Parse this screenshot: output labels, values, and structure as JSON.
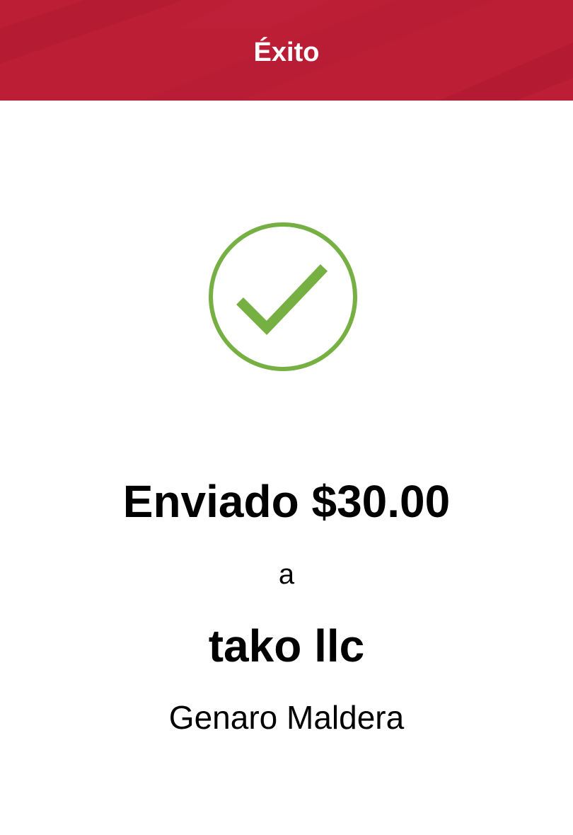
{
  "header": {
    "title": "Éxito",
    "background_color": "#bc1e36"
  },
  "status": {
    "icon": "checkmark-circle-icon",
    "icon_color": "#76b043"
  },
  "confirmation": {
    "sent_label": "Enviado $30.00",
    "connector": "a",
    "recipient_business": "tako llc",
    "recipient_person": "Genaro Maldera"
  }
}
